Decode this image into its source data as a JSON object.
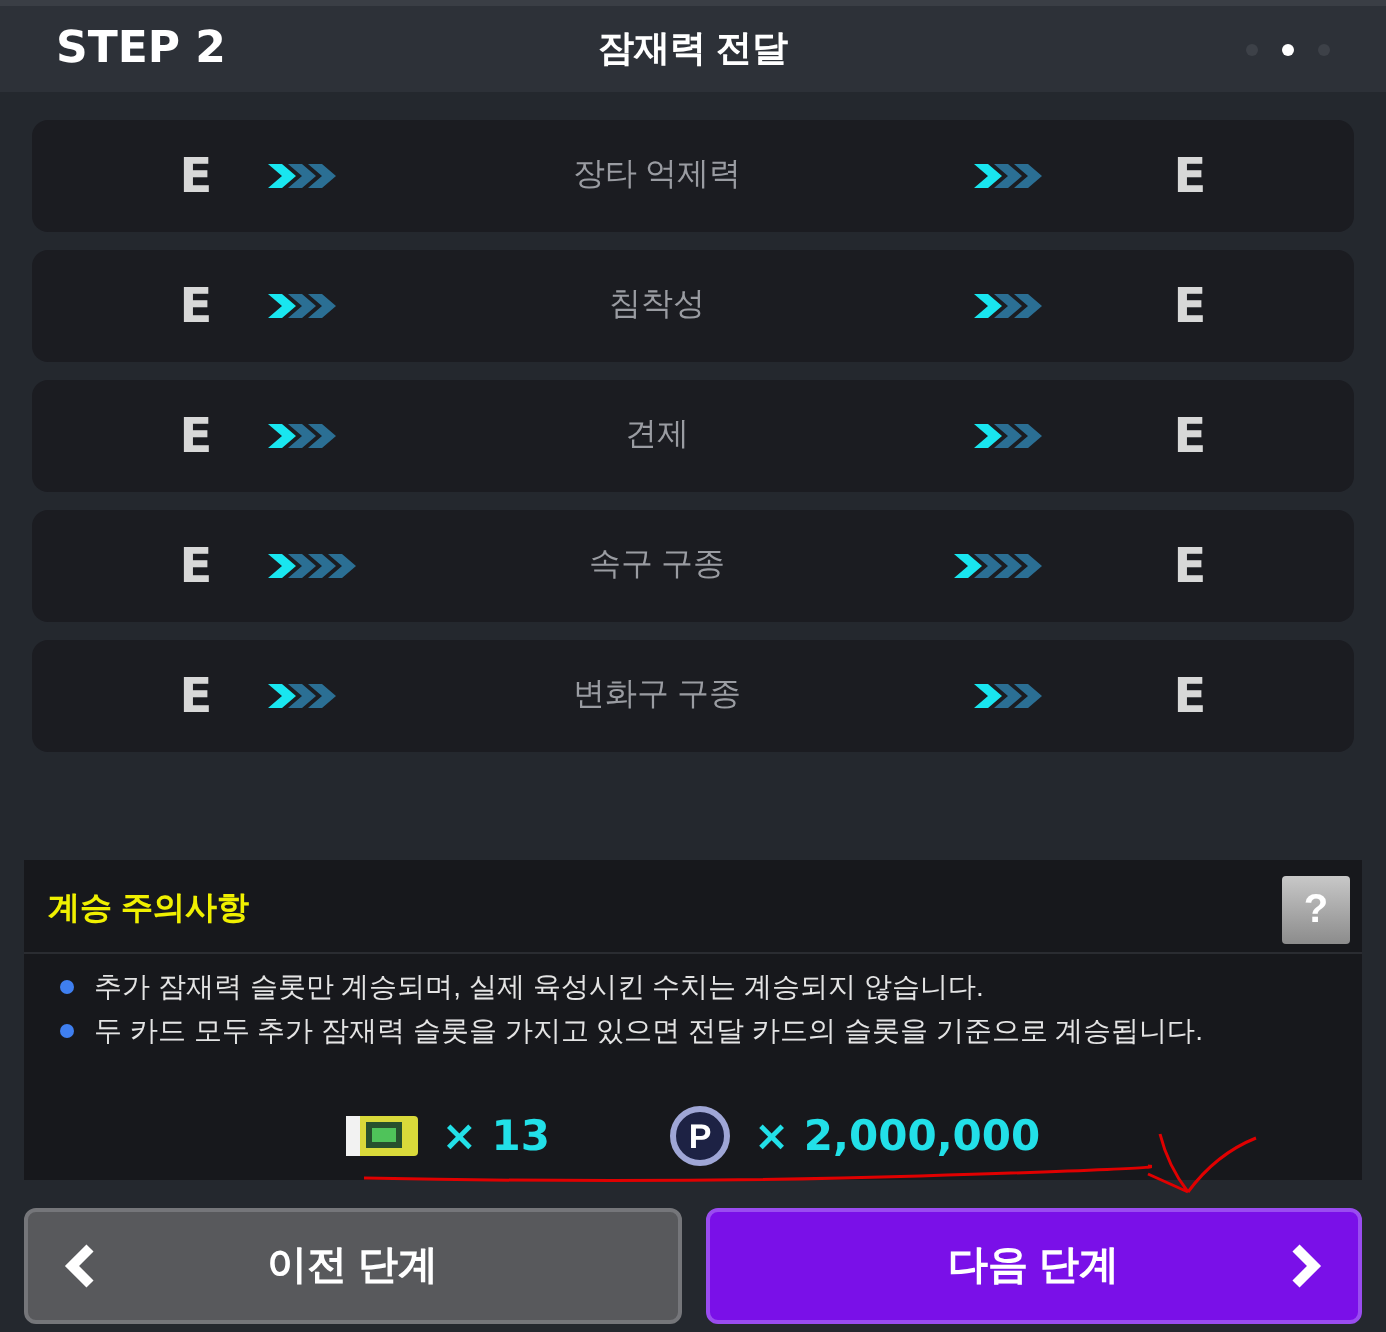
{
  "header": {
    "step": "STEP 2",
    "title": "잠재력 전달",
    "page_dots": [
      {
        "selected": false
      },
      {
        "selected": true
      },
      {
        "selected": false
      }
    ]
  },
  "rows": [
    {
      "left_grade": "E",
      "left_arrows": [
        {
          "lit": true
        },
        {
          "lit": false
        },
        {
          "lit": false
        }
      ],
      "name": "장타 억제력",
      "right_arrows": [
        {
          "lit": true
        },
        {
          "lit": false
        },
        {
          "lit": false
        }
      ],
      "right_grade": "E"
    },
    {
      "left_grade": "E",
      "left_arrows": [
        {
          "lit": true
        },
        {
          "lit": false
        },
        {
          "lit": false
        }
      ],
      "name": "침착성",
      "right_arrows": [
        {
          "lit": true
        },
        {
          "lit": false
        },
        {
          "lit": false
        }
      ],
      "right_grade": "E"
    },
    {
      "left_grade": "E",
      "left_arrows": [
        {
          "lit": true
        },
        {
          "lit": false
        },
        {
          "lit": false
        }
      ],
      "name": "견제",
      "right_arrows": [
        {
          "lit": true
        },
        {
          "lit": false
        },
        {
          "lit": false
        }
      ],
      "right_grade": "E"
    },
    {
      "left_grade": "E",
      "left_arrows": [
        {
          "lit": true
        },
        {
          "lit": false
        },
        {
          "lit": false
        },
        {
          "lit": false
        }
      ],
      "name": "속구 구종",
      "right_arrows": [
        {
          "lit": true
        },
        {
          "lit": false
        },
        {
          "lit": false
        },
        {
          "lit": false
        }
      ],
      "right_grade": "E"
    },
    {
      "left_grade": "E",
      "left_arrows": [
        {
          "lit": true
        },
        {
          "lit": false
        },
        {
          "lit": false
        }
      ],
      "name": "변화구 구종",
      "right_arrows": [
        {
          "lit": true
        },
        {
          "lit": false
        },
        {
          "lit": false
        }
      ],
      "right_grade": "E"
    }
  ],
  "notice": {
    "title": "계승 주의사항",
    "help": "?",
    "items": [
      "추가 잠재력 슬롯만 계승되며, 실제 육성시킨 수치는 계승되지 않습니다.",
      "두 카드 모두 추가 잠재력 슬롯을 가지고 있으면 전달 카드의 슬롯을 기준으로 계승됩니다."
    ]
  },
  "costs": [
    {
      "kind": "ticket",
      "amount": "× 13"
    },
    {
      "kind": "coin",
      "symbol": "P",
      "amount": "× 2,000,000"
    }
  ],
  "buttons": [
    {
      "kind": "prev",
      "label": "이전 단계"
    },
    {
      "kind": "next",
      "label": "다음 단계"
    }
  ]
}
